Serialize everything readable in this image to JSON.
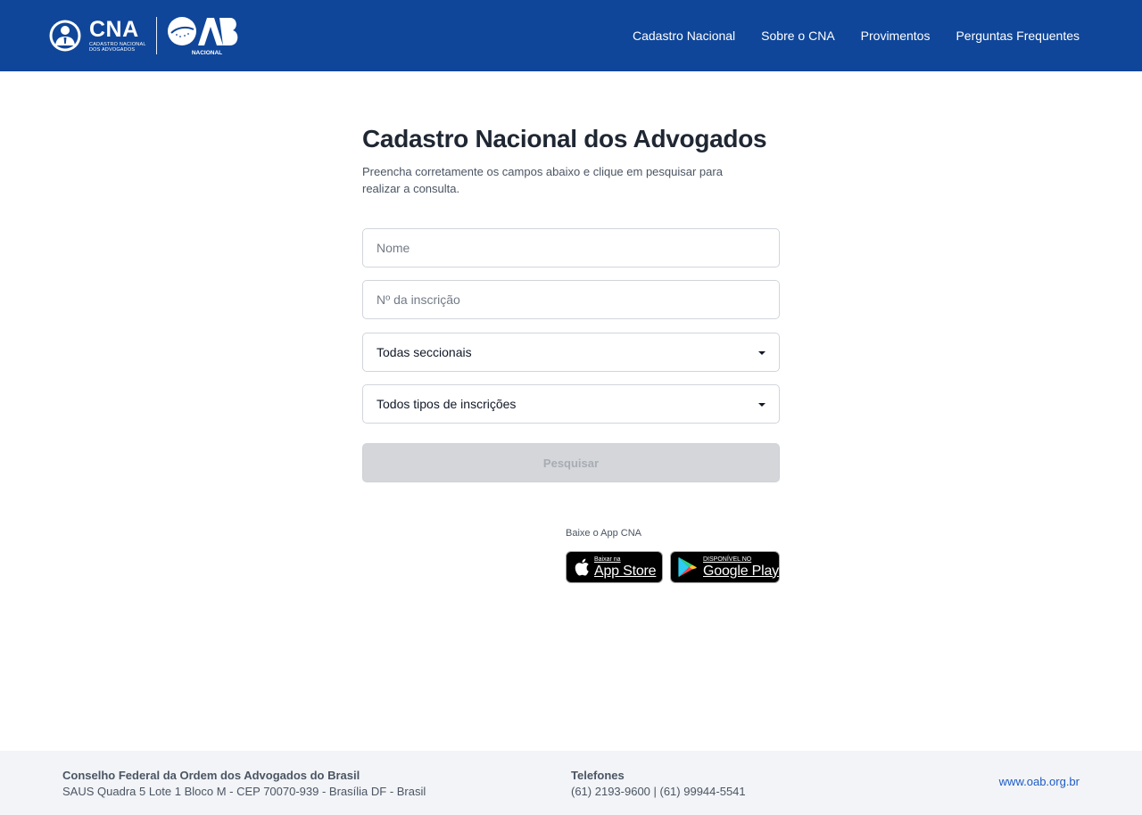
{
  "header": {
    "logo_cna": "CNA",
    "logo_cna_sub_line1": "CADASTRO NACIONAL",
    "logo_cna_sub_line2": "DOS ADVOGADOS",
    "logo_oab": "OAB",
    "logo_oab_sub": "NACIONAL",
    "nav": [
      {
        "label": "Cadastro Nacional"
      },
      {
        "label": "Sobre o CNA"
      },
      {
        "label": "Provimentos"
      },
      {
        "label": "Perguntas Frequentes"
      }
    ]
  },
  "main": {
    "title": "Cadastro Nacional dos Advogados",
    "description": "Preencha corretamente os campos abaixo e clique em pesquisar para realizar a consulta.",
    "form": {
      "name_placeholder": "Nome",
      "registration_placeholder": "Nº da inscrição",
      "sectional_select": "Todas seccionais",
      "type_select": "Todos tipos de inscrições",
      "search_label": "Pesquisar"
    },
    "app": {
      "label": "Baixe o App CNA",
      "appstore_small": "Baixar na",
      "appstore_big": "App Store",
      "gplay_small": "DISPONÍVEL NO",
      "gplay_big": "Google Play"
    }
  },
  "footer": {
    "org_name": "Conselho Federal da Ordem dos Advogados do Brasil",
    "address": "SAUS Quadra 5 Lote 1 Bloco M - CEP 70070-939 - Brasília DF - Brasil",
    "phones_title": "Telefones",
    "phones": "(61) 2193-9600 | (61) 99944-5541",
    "website": "www.oab.org.br"
  },
  "colors": {
    "header_bg": "#0f4699",
    "footer_bg": "#f2f4f7",
    "link": "#1e5bc6",
    "button_disabled": "#d4d6da"
  }
}
